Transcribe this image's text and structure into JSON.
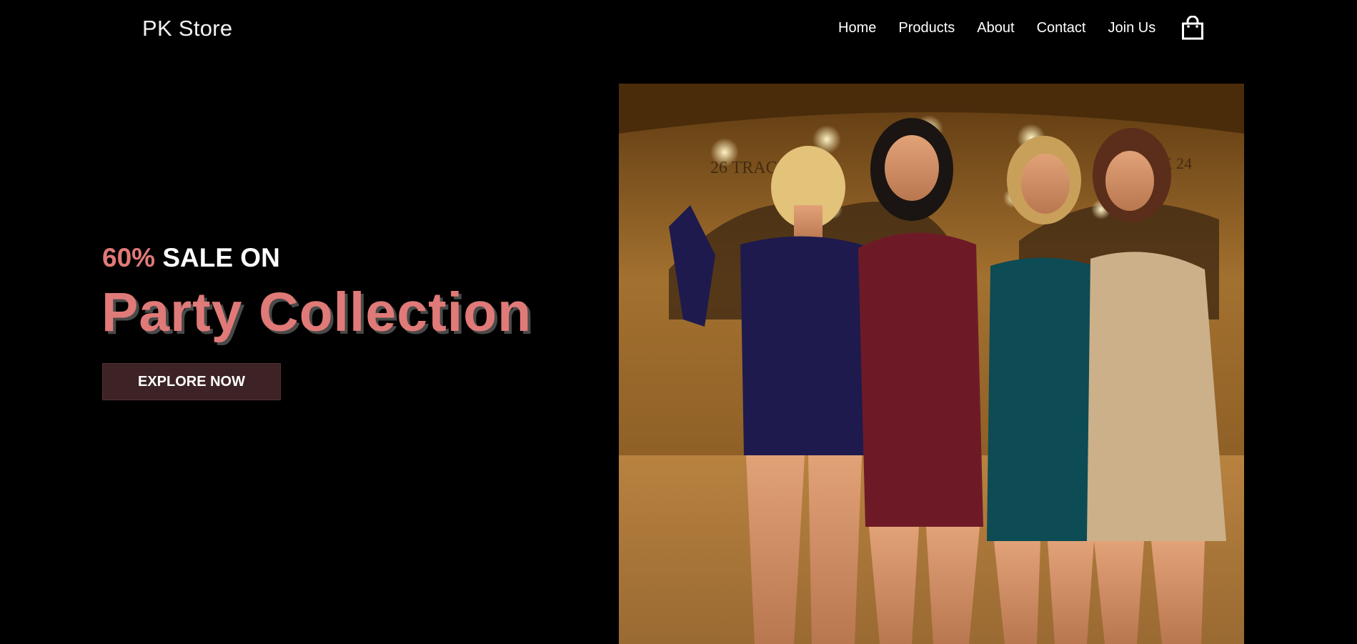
{
  "header": {
    "brand": "PK Store",
    "nav": [
      "Home",
      "Products",
      "About",
      "Contact",
      "Join Us"
    ],
    "cart_icon": "shopping-bag-icon"
  },
  "hero": {
    "discount": "60%",
    "sale_text": "SALE ON",
    "headline": "Party Collection",
    "cta_label": "EXPLORE NOW",
    "photo_signs": {
      "left": "26 TRACKS 25",
      "right": "TRACK 24"
    }
  },
  "colors": {
    "background": "#000000",
    "accent": "#e07a78",
    "button": "#3d2325",
    "text": "#ffffff"
  }
}
